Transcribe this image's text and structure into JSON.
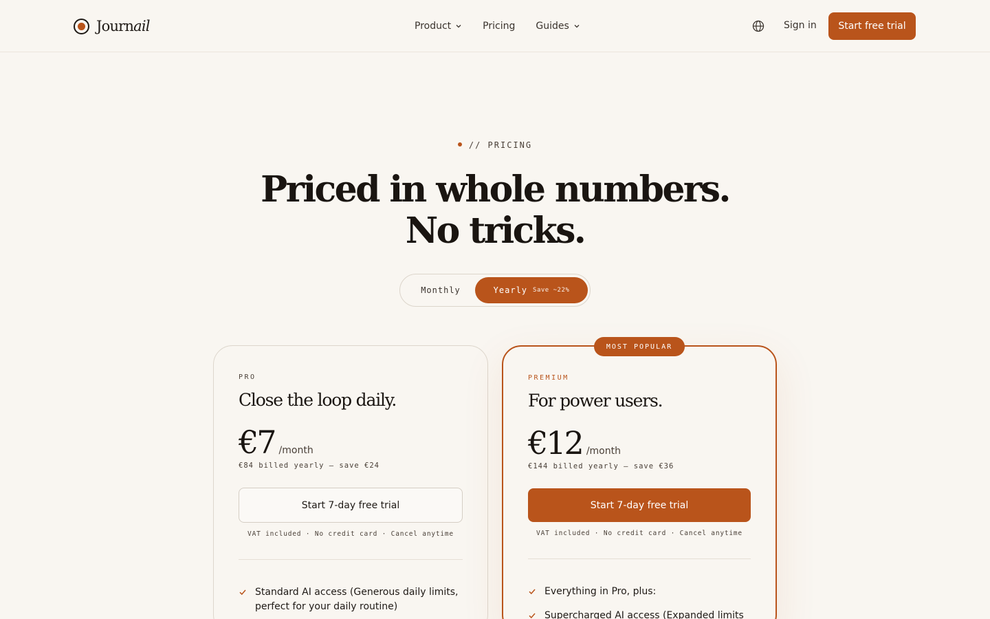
{
  "header": {
    "logo_text_a": "Journ",
    "logo_text_b": "ail",
    "nav": [
      {
        "label": "Product",
        "has_dropdown": true
      },
      {
        "label": "Pricing",
        "has_dropdown": false
      },
      {
        "label": "Guides",
        "has_dropdown": true
      }
    ],
    "language_icon": "globe-icon",
    "signin_label": "Sign in",
    "cta_label": "Start free trial"
  },
  "hero": {
    "eyebrow": "// PRICING",
    "headline_line1": "Priced in whole numbers.",
    "headline_line2": "No tricks."
  },
  "billing_toggle": {
    "monthly_label": "Monthly",
    "yearly_label": "Yearly",
    "yearly_save": "Save ~22%",
    "selected": "yearly"
  },
  "plans": {
    "pro": {
      "tier": "PRO",
      "tagline": "Close the loop daily.",
      "price": "€7",
      "per": "/month",
      "billed": "€84 billed yearly — save €24",
      "cta": "Start 7-day free trial",
      "fine_print": "VAT included · No credit card · Cancel anytime",
      "features": [
        "Standard AI access (Generous daily limits, perfect for your daily routine)"
      ]
    },
    "premium": {
      "badge": "MOST POPULAR",
      "tier": "PREMIUM",
      "tagline": "For power users.",
      "price": "€12",
      "per": "/month",
      "billed": "€144 billed yearly — save €36",
      "cta": "Start 7-day free trial",
      "fine_print": "VAT included · No credit card · Cancel anytime",
      "features": [
        "Everything in Pro, plus:",
        "Supercharged AI access (Expanded limits"
      ]
    }
  },
  "colors": {
    "accent": "#b9541b",
    "background": "#f9f6f1",
    "text": "#1f1a16"
  }
}
